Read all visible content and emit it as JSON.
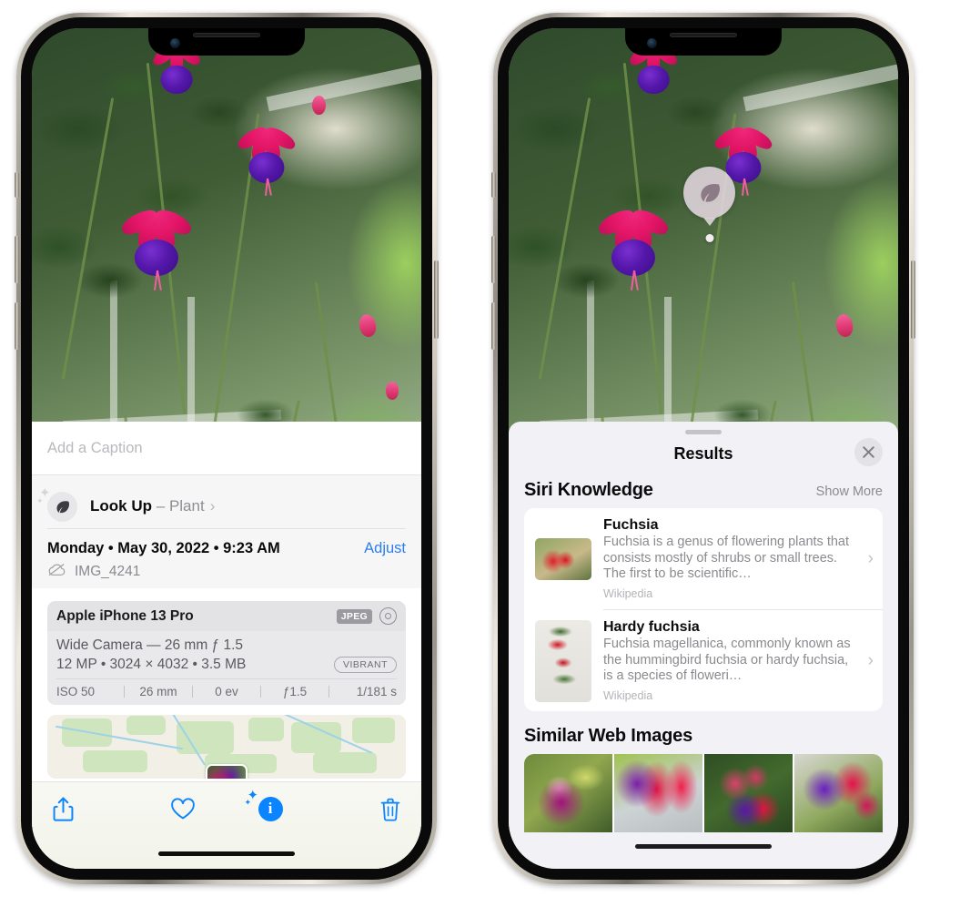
{
  "left_phone": {
    "caption_field": {
      "placeholder": "Add a Caption",
      "value": ""
    },
    "look_up": {
      "icon": "leaf-icon",
      "label": "Look Up",
      "separator": "–",
      "subject": "Plant",
      "chevron": "›"
    },
    "metadata": {
      "date_line": "Monday • May 30, 2022 • 9:23 AM",
      "adjust_label": "Adjust",
      "cloud_icon": "cloud-slash-icon",
      "filename": "IMG_4241"
    },
    "exif": {
      "device": "Apple iPhone 13 Pro",
      "format_tag": "JPEG",
      "lens_icon": "lens-icon",
      "lens_line": "Wide Camera — 26 mm ƒ 1.5",
      "size_line": "12 MP • 3024 × 4032 • 3.5 MB",
      "style_tag": "VIBRANT",
      "stats": [
        "ISO 50",
        "26 mm",
        "0 ev",
        "ƒ1.5",
        "1/181 s"
      ]
    },
    "toolbar": {
      "share_icon": "share-icon",
      "favorite_icon": "heart-icon",
      "info_icon": "info-sparkle-icon",
      "delete_icon": "trash-icon"
    }
  },
  "right_phone": {
    "visual_lookup_badge": {
      "icon": "leaf-icon"
    },
    "sheet": {
      "title": "Results",
      "close_icon": "close-icon",
      "grabber": "drag-handle"
    },
    "siri_knowledge": {
      "section_title": "Siri Knowledge",
      "show_more": "Show More",
      "items": [
        {
          "title": "Fuchsia",
          "description": "Fuchsia is a genus of flowering plants that consists mostly of shrubs or small trees. The first to be scientific…",
          "source": "Wikipedia",
          "chevron": "›"
        },
        {
          "title": "Hardy fuchsia",
          "description": "Fuchsia magellanica, commonly known as the hummingbird fuchsia or hardy fuchsia, is a species of floweri…",
          "source": "Wikipedia",
          "chevron": "›"
        }
      ]
    },
    "similar_web_images": {
      "section_title": "Similar Web Images",
      "thumbnails": [
        "fuchsia-thumb-1",
        "fuchsia-thumb-2",
        "fuchsia-thumb-3",
        "fuchsia-thumb-4"
      ]
    }
  },
  "colors": {
    "accent_blue": "#2a7ef0",
    "sheet_gray": "#f2f2f6",
    "card_white": "#ffffff",
    "secondary_text": "#8a8a8f"
  }
}
